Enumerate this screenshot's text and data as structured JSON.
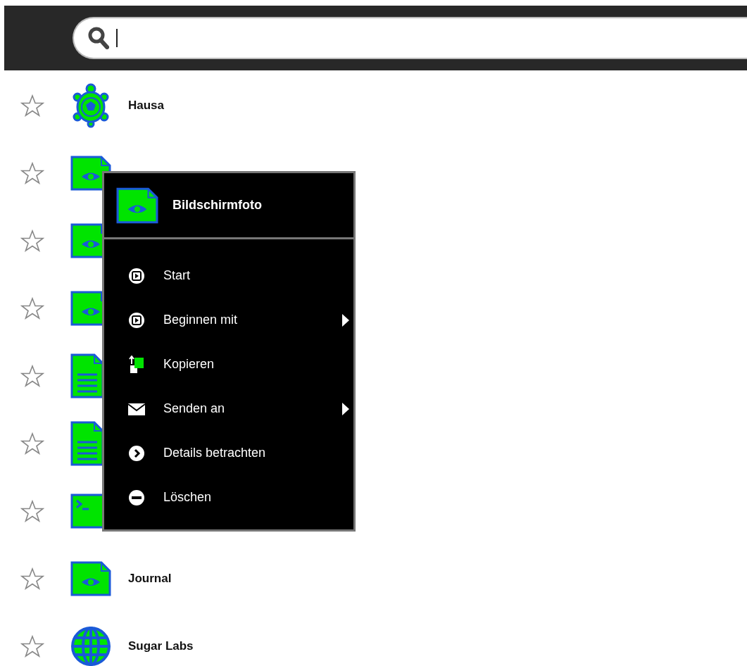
{
  "search": {
    "focused": true
  },
  "entries": [
    {
      "title": "Hausa",
      "kind": "turtle",
      "starred": false
    },
    {
      "kind": "image",
      "starred": false
    },
    {
      "kind": "image",
      "starred": false
    },
    {
      "kind": "image",
      "starred": false
    },
    {
      "kind": "text",
      "starred": false
    },
    {
      "kind": "text",
      "starred": false
    },
    {
      "kind": "terminal",
      "starred": false
    },
    {
      "title": "Journal",
      "kind": "image",
      "starred": false
    },
    {
      "title": "Sugar Labs",
      "kind": "globe",
      "starred": false
    }
  ],
  "context_menu": {
    "title": "Bildschirmfoto",
    "kind": "image",
    "items": [
      {
        "label": "Start",
        "kind": "play",
        "submenu": false
      },
      {
        "label": "Beginnen mit",
        "kind": "play",
        "submenu": true
      },
      {
        "label": "Kopieren",
        "kind": "copy",
        "submenu": false
      },
      {
        "label": "Senden an",
        "kind": "mail",
        "submenu": true
      },
      {
        "label": "Details betrachten",
        "kind": "details",
        "submenu": false
      },
      {
        "label": "Löschen",
        "kind": "remove",
        "submenu": false
      }
    ]
  }
}
